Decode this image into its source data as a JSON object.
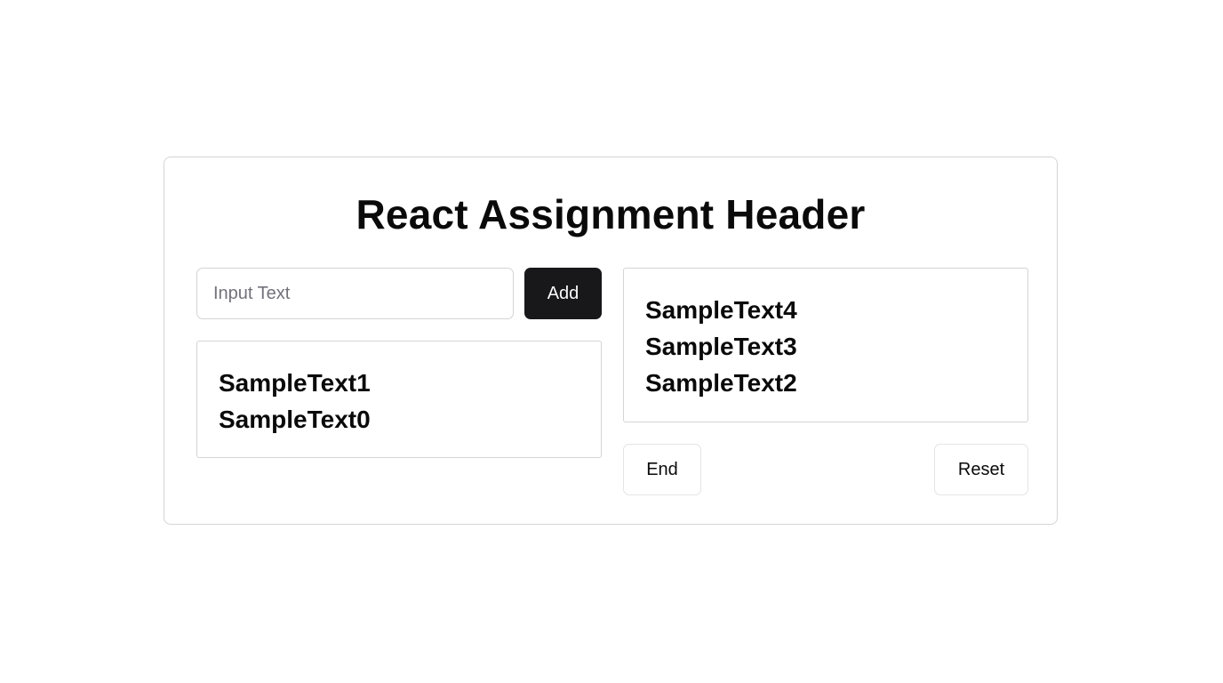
{
  "header": {
    "title": "React Assignment Header"
  },
  "input": {
    "value": "",
    "placeholder": "Input Text"
  },
  "buttons": {
    "add_label": "Add",
    "end_label": "End",
    "reset_label": "Reset"
  },
  "left_list": {
    "items": [
      "SampleText1",
      "SampleText0"
    ]
  },
  "right_list": {
    "items": [
      "SampleText4",
      "SampleText3",
      "SampleText2"
    ]
  },
  "colors": {
    "primary_button_bg": "#18181b",
    "primary_button_text": "#fafafa",
    "border": "#d4d4d8",
    "placeholder": "#71717a"
  }
}
